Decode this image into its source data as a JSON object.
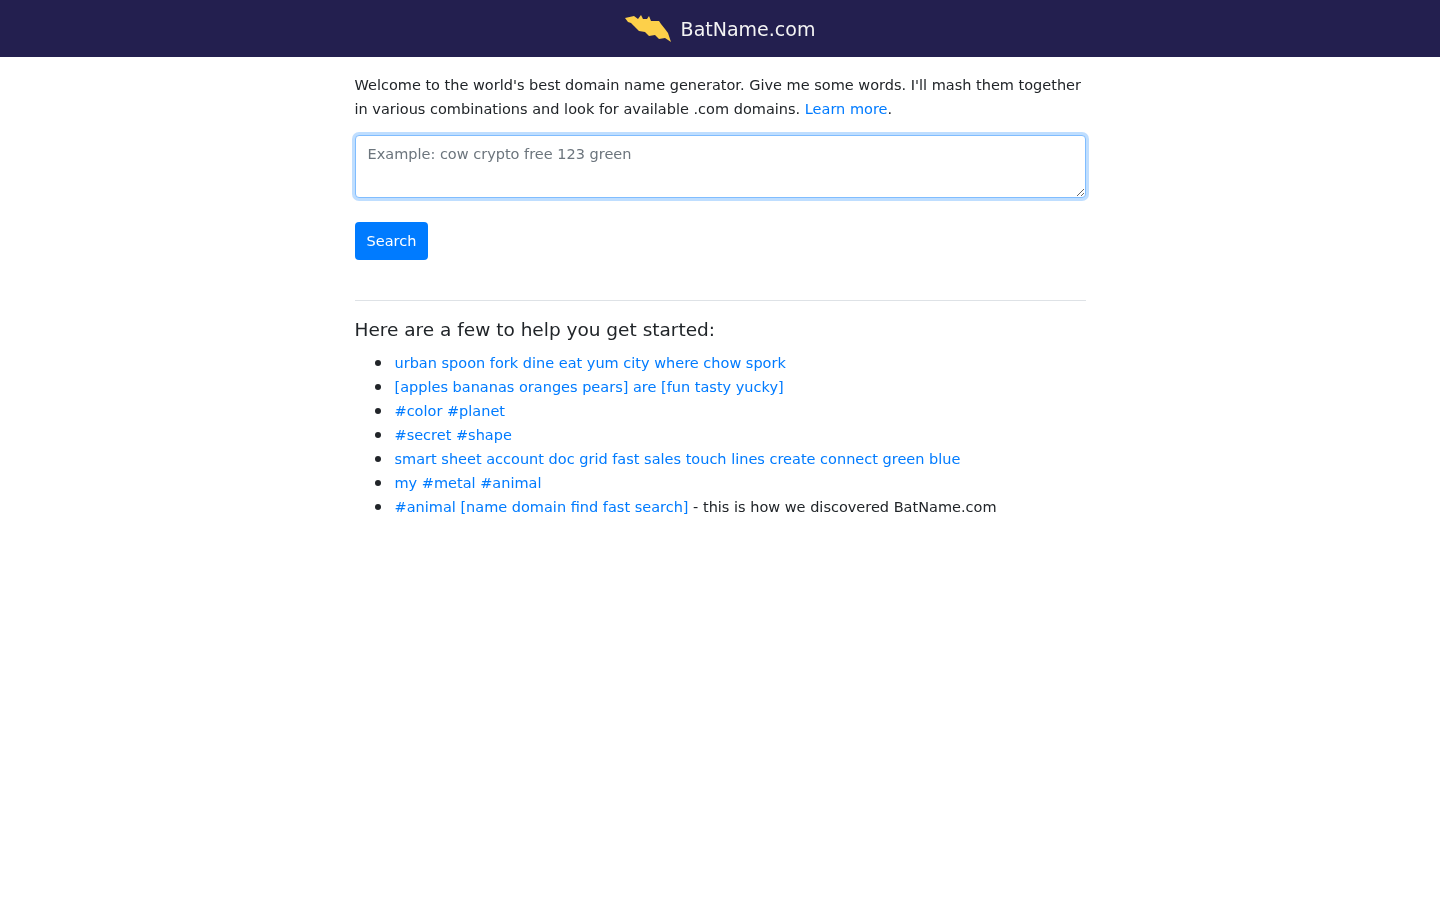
{
  "header": {
    "title": "BatName.com"
  },
  "intro": {
    "text": "Welcome to the world's best domain name generator. Give me some words. I'll mash them together in various combinations and look for available .com domains. ",
    "link": "Learn more",
    "after": "."
  },
  "search": {
    "placeholder": "Example: cow crypto free 123 green",
    "focused": true,
    "button": "Search"
  },
  "examples": {
    "heading": "Here are a few to help you get started:",
    "items": [
      {
        "link": "urban spoon fork dine eat yum city where chow spork"
      },
      {
        "link": "[apples bananas oranges pears] are [fun tasty yucky]"
      },
      {
        "link": "#color #planet"
      },
      {
        "link": "#secret #shape"
      },
      {
        "link": "smart sheet account doc grid fast sales touch lines create connect green blue"
      },
      {
        "link": "my #metal #animal"
      },
      {
        "link": "#animal [name domain find fast search]",
        "note": " - this is how we discovered BatName.com"
      }
    ]
  }
}
